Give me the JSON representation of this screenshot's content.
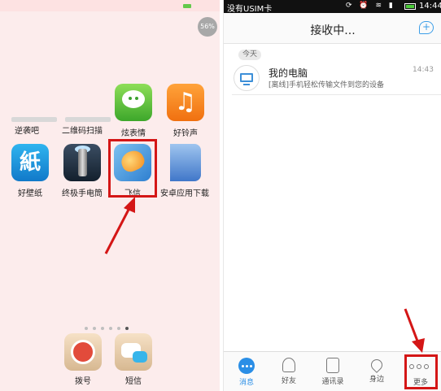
{
  "left_screen": {
    "battery_percent": "56%",
    "apps_row1": [
      {
        "label": "炫表情",
        "icon": "chat-face-icon"
      },
      {
        "label": "好铃声",
        "icon": "music-note-icon"
      }
    ],
    "apps_row2_partial": [
      {
        "label": "逆袭吧"
      },
      {
        "label": "二维码扫描"
      }
    ],
    "apps_row3": [
      {
        "label": "好壁纸",
        "icon": "wallpaper-icon",
        "glyph": "紙"
      },
      {
        "label": "终极手电筒",
        "icon": "flashlight-icon"
      },
      {
        "label": "飞信",
        "icon": "fetion-icon"
      },
      {
        "label": "安卓应用下载",
        "icon": "android-store-icon"
      }
    ],
    "page_dots": 6,
    "active_dot": 5,
    "dock": [
      {
        "label": "拨号",
        "icon": "dialer-icon"
      },
      {
        "label": "短信",
        "icon": "sms-icon"
      }
    ],
    "highlight_color": "#d41616"
  },
  "right_screen": {
    "status": {
      "carrier": "没有USIM卡",
      "time": "14:44"
    },
    "title": "接收中...",
    "date_badge": "今天",
    "conversations": [
      {
        "name": "我的电脑",
        "preview": "[离线]手机轻松传输文件到您的设备",
        "time": "14:43"
      }
    ],
    "tabs": [
      {
        "label": "消息",
        "icon": "message-icon",
        "active": true
      },
      {
        "label": "好友",
        "icon": "friends-icon",
        "active": false
      },
      {
        "label": "通讯录",
        "icon": "contacts-icon",
        "active": false
      },
      {
        "label": "身边",
        "icon": "nearby-icon",
        "active": false
      },
      {
        "label": "更多",
        "icon": "more-icon",
        "active": false
      }
    ],
    "accent_color": "#2a8ee6"
  }
}
